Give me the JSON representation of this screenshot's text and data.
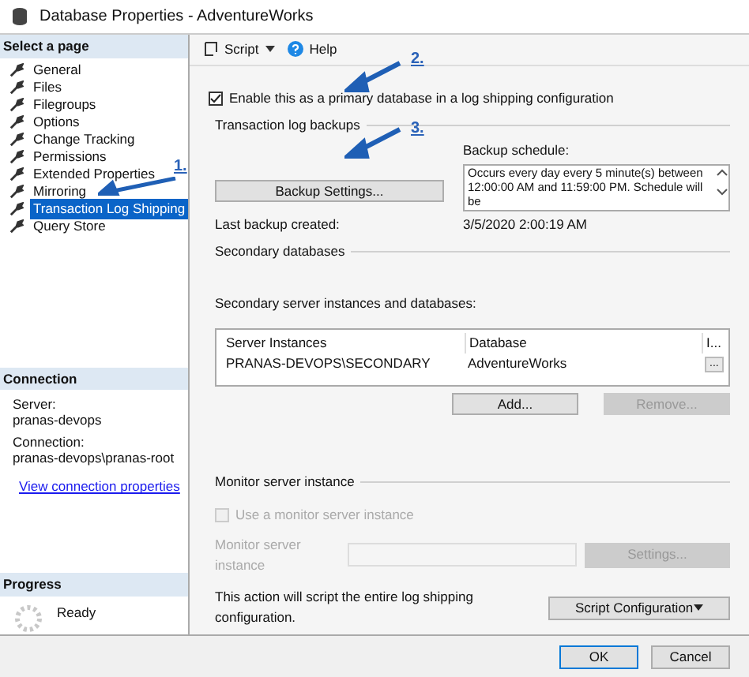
{
  "window": {
    "title": "Database Properties - AdventureWorks"
  },
  "sidebar": {
    "header": "Select a page",
    "items": [
      {
        "label": "General",
        "selected": false
      },
      {
        "label": "Files",
        "selected": false
      },
      {
        "label": "Filegroups",
        "selected": false
      },
      {
        "label": "Options",
        "selected": false
      },
      {
        "label": "Change Tracking",
        "selected": false
      },
      {
        "label": "Permissions",
        "selected": false
      },
      {
        "label": "Extended Properties",
        "selected": false
      },
      {
        "label": "Mirroring",
        "selected": false
      },
      {
        "label": "Transaction Log Shipping",
        "selected": true
      },
      {
        "label": "Query Store",
        "selected": false
      }
    ]
  },
  "connection": {
    "header": "Connection",
    "server_label": "Server:",
    "server": "pranas-devops",
    "connection_label": "Connection:",
    "connection": "pranas-devops\\pranas-root",
    "link": "View connection properties"
  },
  "progress": {
    "header": "Progress",
    "status": "Ready"
  },
  "toolbar": {
    "script": "Script",
    "help": "Help"
  },
  "primary_checkbox": {
    "label": "Enable this as a primary database in a log shipping configuration",
    "checked": true
  },
  "transaction_log_backups": {
    "title": "Transaction log backups",
    "button": "Backup Settings...",
    "schedule_label": "Backup schedule:",
    "schedule": "Occurs every day every 5 minute(s) between 12:00:00 AM and 11:59:00 PM. Schedule will be",
    "last_backup_label": "Last backup created:",
    "last_backup": "3/5/2020 2:00:19 AM"
  },
  "secondary_databases": {
    "title": "Secondary databases",
    "label": "Secondary server instances and databases:",
    "columns": [
      "Server Instances",
      "Database",
      "I..."
    ],
    "rows": [
      {
        "server": "PRANAS-DEVOPS\\SECONDARY",
        "database": "AdventureWorks",
        "button": "..."
      }
    ],
    "add": "Add...",
    "remove": {
      "label": "Remove...",
      "disabled": true
    }
  },
  "monitor": {
    "title": "Monitor server instance",
    "checkbox": {
      "label": "Use a monitor server instance",
      "checked": false,
      "disabled": true
    },
    "field_label": "Monitor server instance",
    "settings": "Settings..."
  },
  "script_note": "This action will script the entire log shipping configuration.",
  "script_button": "Script Configuration",
  "buttons": [
    "OK",
    "Cancel"
  ],
  "annotations": [
    "1.",
    "2.",
    "3."
  ]
}
